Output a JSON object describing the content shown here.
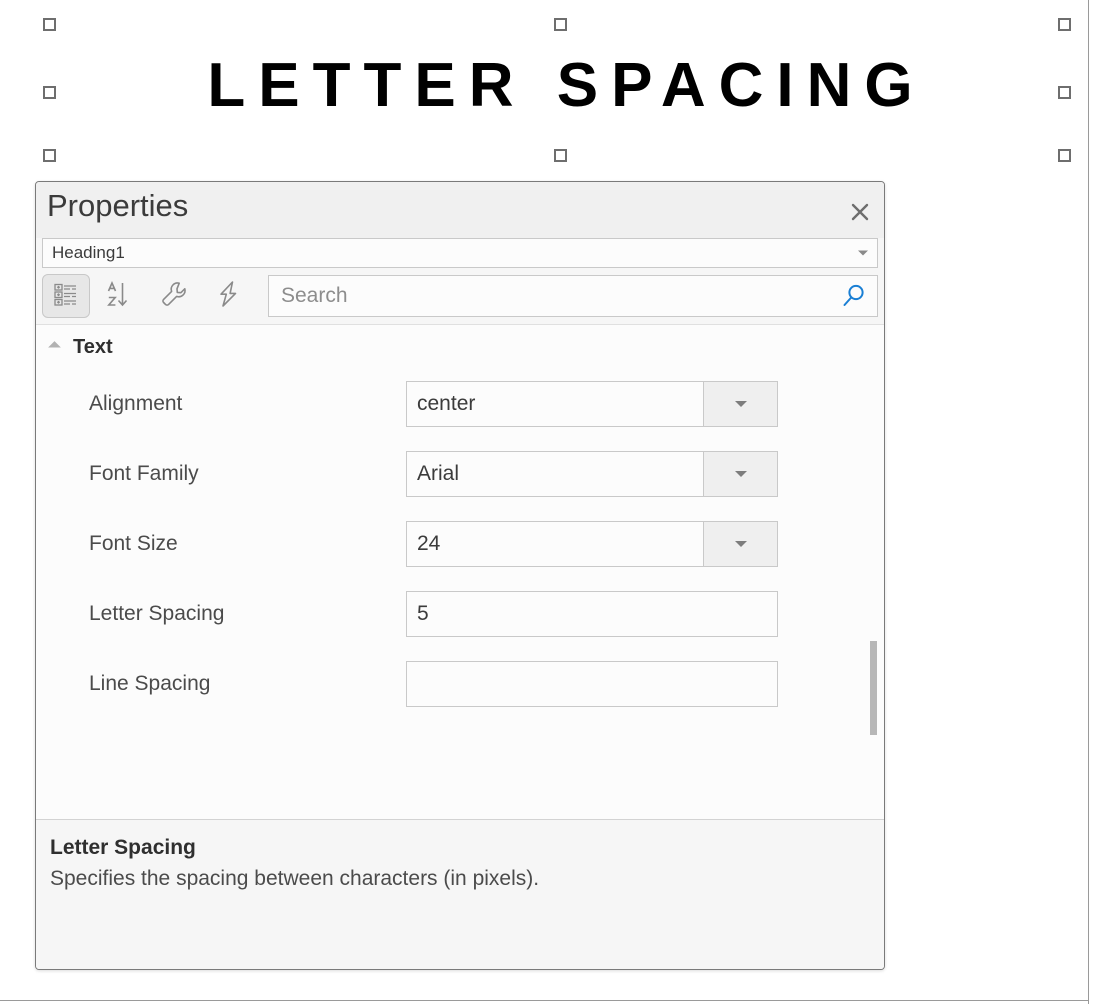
{
  "canvas": {
    "heading_text": "LETTER SPACING",
    "selection_handles": [
      "handle-top-left",
      "handle-top-center",
      "handle-top-right",
      "handle-middle-left",
      "handle-middle-right",
      "handle-bottom-left",
      "handle-bottom-center",
      "handle-bottom-right"
    ]
  },
  "panel": {
    "title": "Properties",
    "close_label": "×",
    "object_selector": {
      "value": "Heading1",
      "caret_icon": "chevron-down-icon"
    },
    "toolbar": {
      "buttons": [
        {
          "name": "categorized-view-button",
          "icon": "categorized-list-icon",
          "active": true
        },
        {
          "name": "alphabetical-sort-button",
          "icon": "sort-a-z-icon",
          "active": false
        },
        {
          "name": "properties-button",
          "icon": "wrench-icon",
          "active": false
        },
        {
          "name": "events-button",
          "icon": "lightning-bolt-icon",
          "active": false
        }
      ],
      "search": {
        "placeholder": "Search",
        "value": "",
        "icon": "search-icon",
        "icon_color": "#1a7fd4"
      }
    },
    "groups": [
      {
        "label": "Text",
        "expanded": true,
        "rows": [
          {
            "label": "Alignment",
            "value": "center",
            "type": "combobox"
          },
          {
            "label": "Font Family",
            "value": "Arial",
            "type": "combobox"
          },
          {
            "label": "Font Size",
            "value": "24",
            "type": "combobox"
          },
          {
            "label": "Letter Spacing",
            "value": "5",
            "type": "textbox"
          },
          {
            "label": "Line Spacing",
            "value": "",
            "type": "textbox"
          }
        ]
      }
    ],
    "description": {
      "title": "Letter Spacing",
      "body": "Specifies the spacing between characters (in pixels)."
    }
  }
}
